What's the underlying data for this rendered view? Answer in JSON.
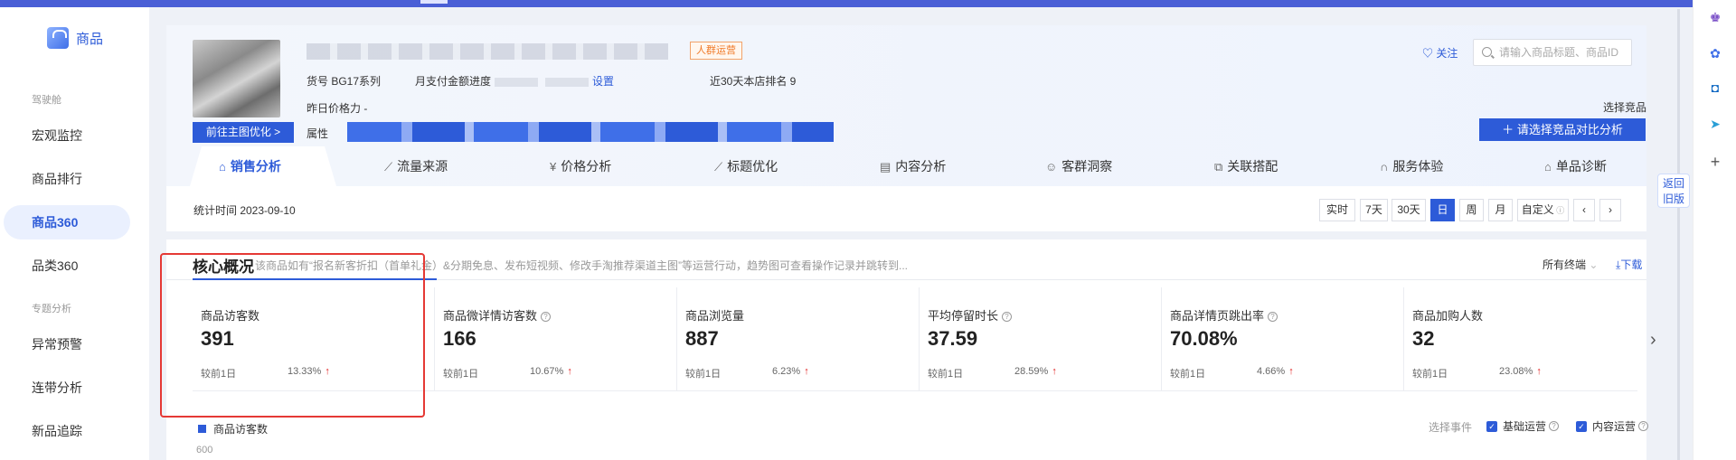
{
  "sidebar": {
    "brand": "商品",
    "groups": [
      "驾驶舱",
      "专题分析"
    ],
    "items": [
      {
        "label": "宏观监控"
      },
      {
        "label": "商品排行"
      },
      {
        "label": "商品360",
        "active": true
      },
      {
        "label": "品类360"
      },
      {
        "label": "异常预警"
      },
      {
        "label": "连带分析"
      },
      {
        "label": "新品追踪"
      }
    ]
  },
  "product": {
    "tag": "人群运营",
    "sku_label": "货号 BG17系列",
    "monthly_pay": "月支付金额进度",
    "link_view": "设置",
    "rank": "近30天本店排名 9",
    "yesterday_price": "昨日价格力  -",
    "attr_label": "属性",
    "main_img_btn": "前往主图优化 >",
    "follow": "关注",
    "search_placeholder": "请输入商品标题、商品ID",
    "select_label": "选择竞品",
    "compare_btn": "请选择竞品对比分析"
  },
  "tabs": [
    {
      "label": "销售分析",
      "icon": "bag-icon",
      "active": true
    },
    {
      "label": "流量来源",
      "icon": "chart-icon"
    },
    {
      "label": "价格分析",
      "icon": "yen-icon"
    },
    {
      "label": "标题优化",
      "icon": "chart-icon"
    },
    {
      "label": "内容分析",
      "icon": "doc-icon"
    },
    {
      "label": "客群洞察",
      "icon": "people-icon"
    },
    {
      "label": "关联搭配",
      "icon": "link-icon"
    },
    {
      "label": "服务体验",
      "icon": "headset-icon"
    },
    {
      "label": "单品诊断",
      "icon": "bag-icon"
    }
  ],
  "stat_time": "统计时间 2023-09-10",
  "time_buttons": [
    "实时",
    "7天",
    "30天",
    "日",
    "周",
    "月",
    "自定义"
  ],
  "time_active": "日",
  "return_tab": [
    "返回",
    "旧版"
  ],
  "core": {
    "title": "核心概况",
    "desc": "该商品如有“报名新客折扣（首单礼金）&分期免息、发布短视频、修改手淘推荐渠道主图”等运营行动，趋势图可查看操作记录并跳转到...",
    "all_terms": "所有终端",
    "download": "下载",
    "metrics": [
      {
        "label": "商品访客数",
        "value": "391",
        "cmp": "较前1日",
        "pct": "13.33%",
        "help": false
      },
      {
        "label": "商品微详情访客数",
        "value": "166",
        "cmp": "较前1日",
        "pct": "10.67%",
        "help": true
      },
      {
        "label": "商品浏览量",
        "value": "887",
        "cmp": "较前1日",
        "pct": "6.23%",
        "help": false
      },
      {
        "label": "平均停留时长",
        "value": "37.59",
        "cmp": "较前1日",
        "pct": "28.59%",
        "help": true
      },
      {
        "label": "商品详情页跳出率",
        "value": "70.08%",
        "cmp": "较前1日",
        "pct": "4.66%",
        "help": true
      },
      {
        "label": "商品加购人数",
        "value": "32",
        "cmp": "较前1日",
        "pct": "23.08%",
        "help": false
      }
    ],
    "legend": "商品访客数",
    "events_label": "选择事件",
    "events": [
      "基础运营",
      "内容运营"
    ],
    "y_tick": "600"
  },
  "colors": {
    "accent": "#2d5bd8",
    "up": "#e02020",
    "highlight": "#e53935"
  }
}
